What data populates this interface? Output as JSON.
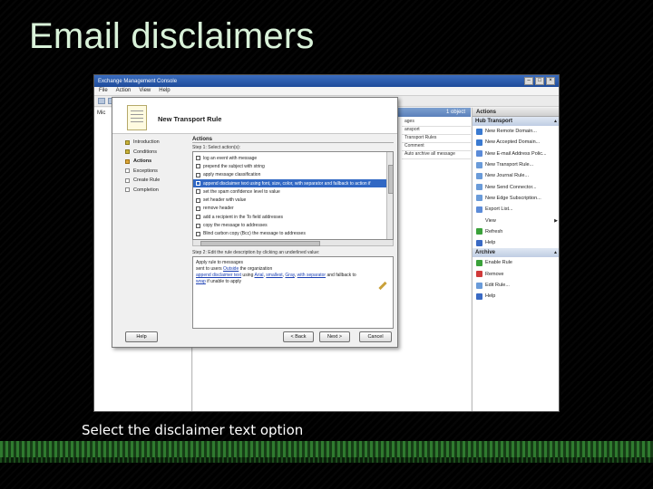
{
  "slide": {
    "title": "Email disclaimers",
    "caption": "Select the disclaimer text option"
  },
  "console": {
    "window_title": "Exchange Management Console",
    "menu": [
      "File",
      "Action",
      "View",
      "Help"
    ],
    "tree_root": "Mic",
    "center_header": "1 object",
    "center_tabs": [
      "ages",
      "ansport",
      "Transport Rules"
    ],
    "center_rows": [
      "Comment",
      "Auto archive all message"
    ],
    "actions_title": "Actions",
    "hub_transport_label": "Hub Transport",
    "hub_actions": [
      {
        "label": "New Remote Domain...",
        "icon": "globe-icon",
        "color": "#3a7ad1"
      },
      {
        "label": "New Accepted Domain...",
        "icon": "domain-icon",
        "color": "#3a7ad1"
      },
      {
        "label": "New E-mail Address Polic...",
        "icon": "mail-icon",
        "color": "#5b8bd8"
      },
      {
        "label": "New Transport Rule...",
        "icon": "rule-icon",
        "color": "#6a9bd9"
      },
      {
        "label": "New Journal Rule...",
        "icon": "journal-icon",
        "color": "#6a9bd9"
      },
      {
        "label": "New Send Connector...",
        "icon": "connector-icon",
        "color": "#6a9bd9"
      },
      {
        "label": "New Edge Subscription...",
        "icon": "subscription-icon",
        "color": "#6a9bd9"
      },
      {
        "label": "Export List...",
        "icon": "export-icon",
        "color": "#5b8bd8"
      },
      {
        "label": "View",
        "icon": "",
        "color": "#ffffff",
        "submenu": true
      },
      {
        "label": "Refresh",
        "icon": "refresh-icon",
        "color": "#3aa13a"
      },
      {
        "label": "Help",
        "icon": "help-icon",
        "color": "#3a6ac4"
      }
    ],
    "archive_label": "Archive",
    "archive_actions": [
      {
        "label": "Enable Rule",
        "icon": "enable-icon",
        "color": "#3aa13a"
      },
      {
        "label": "Remove",
        "icon": "remove-icon",
        "color": "#d03a3a"
      },
      {
        "label": "Edit Rule...",
        "icon": "edit-icon",
        "color": "#6a9bd9"
      },
      {
        "label": "Help",
        "icon": "help-icon",
        "color": "#3a6ac4"
      }
    ]
  },
  "wizard": {
    "title": "New Transport Rule",
    "steps": [
      {
        "label": "Introduction",
        "state": "done"
      },
      {
        "label": "Conditions",
        "state": "done"
      },
      {
        "label": "Actions",
        "state": "current"
      },
      {
        "label": "Exceptions",
        "state": "pending"
      },
      {
        "label": "Create Rule",
        "state": "pending"
      },
      {
        "label": "Completion",
        "state": "pending"
      }
    ],
    "section_title": "Actions",
    "step1_label": "Step 1: Select action(s):",
    "actions_list": [
      {
        "label": "log an event with message",
        "selected": false
      },
      {
        "label": "prepend the subject with string",
        "selected": false
      },
      {
        "label": "apply message classification",
        "selected": false
      },
      {
        "label": "append disclaimer text using font, size, color, with separator and fallback to action if",
        "selected": true
      },
      {
        "label": "set the spam confidence level to value",
        "selected": false
      },
      {
        "label": "set header with value",
        "selected": false
      },
      {
        "label": "remove header",
        "selected": false
      },
      {
        "label": "add a recipient in the To field addresses",
        "selected": false
      },
      {
        "label": "copy the message to addresses",
        "selected": false
      },
      {
        "label": "Blind carbon copy (Bcc) the message to addresses",
        "selected": false
      },
      {
        "label": "redirect the message to addresses",
        "selected": false
      }
    ],
    "step2_label": "Step 2: Edit the rule description by clicking an underlined value:",
    "description": {
      "line1": "Apply rule to messages",
      "line2_prefix": "sent to users ",
      "line2_link": "Outside",
      "line2_suffix": " the organization",
      "line3_link1": "append disclaimer text",
      "line3_mid": " using ",
      "line3_link2": "Arial",
      "line3_c1": ", ",
      "line3_link3": "smallest",
      "line3_c2": ", ",
      "line3_link4": "Gray",
      "line3_c3": ", ",
      "line3_link5": "with separator",
      "line3_suffix": " and fallback to",
      "line4_link": "wrap",
      "line4_suffix": " if unable to apply"
    },
    "buttons": {
      "help": "Help",
      "back": "< Back",
      "next": "Next >",
      "cancel": "Cancel"
    }
  }
}
